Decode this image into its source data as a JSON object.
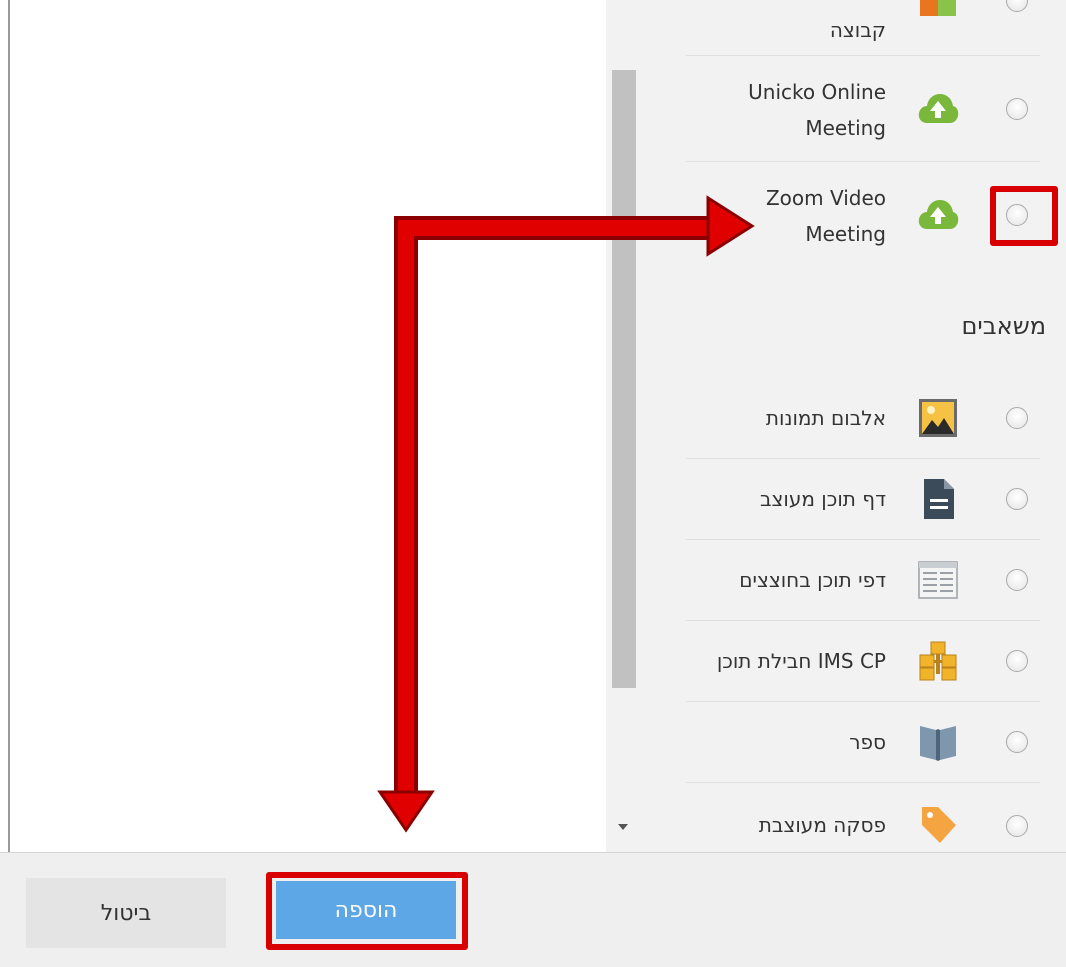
{
  "activities": {
    "partial_item": {
      "label": "קבוצה",
      "icon": "group-icon"
    },
    "items": [
      {
        "label_line1": "Unicko Online",
        "label_line2": "Meeting",
        "icon": "upload-cloud-icon"
      },
      {
        "label_line1": "Zoom Video",
        "label_line2": "Meeting",
        "icon": "upload-cloud-icon"
      }
    ]
  },
  "resources": {
    "title": "משאבים",
    "items": [
      {
        "label": "אלבום תמונות",
        "icon": "image-album-icon"
      },
      {
        "label": "דף תוכן מעוצב",
        "icon": "document-icon"
      },
      {
        "label": "דפי תוכן בחוצצים",
        "icon": "tabbed-pages-icon"
      },
      {
        "label": "חבילת תוכן IMS CP",
        "icon": "package-icon"
      },
      {
        "label": "ספר",
        "icon": "book-icon"
      },
      {
        "label": "פסקה מעוצבת",
        "icon": "label-tag-icon"
      }
    ]
  },
  "footer": {
    "cancel_label": "ביטול",
    "add_label": "הוספה"
  },
  "colors": {
    "highlight": "#d80000",
    "primary_button": "#5ea7e6",
    "plugin_green": "#7ab83c",
    "panel_background": "#f2f2f2"
  }
}
